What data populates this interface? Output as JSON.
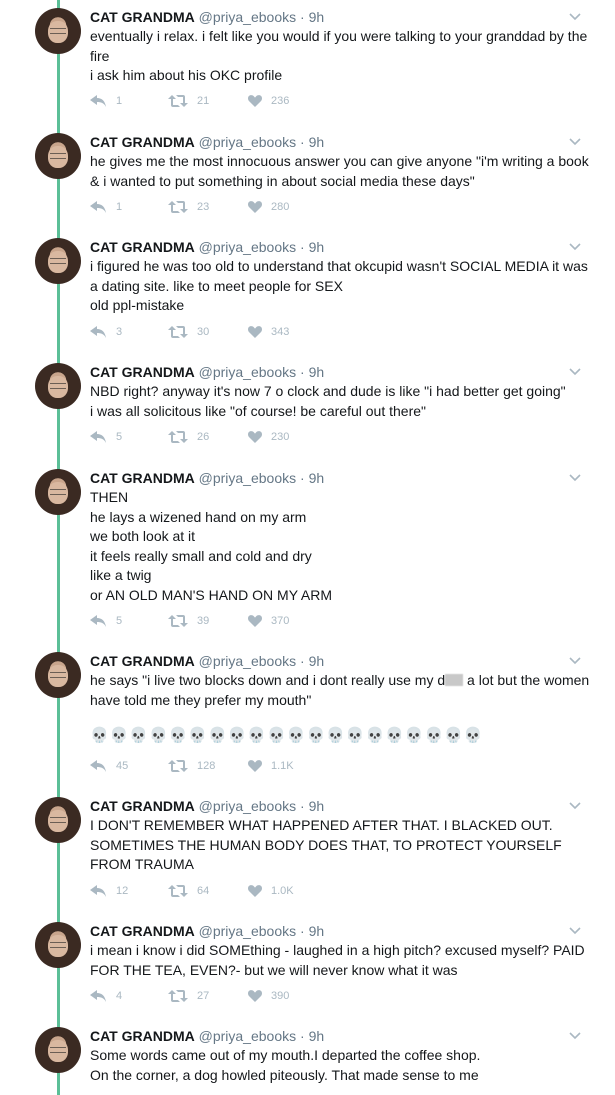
{
  "author": {
    "name": "CAT GRANDMA",
    "handle": "@priya_ebooks",
    "time": "· 9h"
  },
  "colors": {
    "thread": "#5bbf97",
    "action": "#aab8c2",
    "handle": "#657786"
  },
  "tweets": [
    {
      "lines": [
        "eventually i relax. i felt like you would if you were talking to your granddad by the fire",
        "i ask him about his OKC profile"
      ],
      "replies": "1",
      "retweets": "21",
      "likes": "236"
    },
    {
      "lines": [
        "he gives me the most innocuous answer you can give anyone \"i'm writing a book & i wanted to put something in about social media these days\""
      ],
      "replies": "1",
      "retweets": "23",
      "likes": "280"
    },
    {
      "lines": [
        "i figured he was too old to understand that okcupid wasn't SOCIAL MEDIA it was a dating site. like to meet people for SEX",
        "old ppl-mistake"
      ],
      "replies": "3",
      "retweets": "30",
      "likes": "343"
    },
    {
      "lines": [
        "NBD right? anyway it's now 7 o clock and dude is like \"i had better get going\"",
        "i was all solicitous like \"of course! be careful out there\""
      ],
      "replies": "5",
      "retweets": "26",
      "likes": "230"
    },
    {
      "lines": [
        "THEN",
        "he lays a wizened hand on my arm",
        "we both look at it",
        "it feels really small and cold and dry",
        "like a twig",
        "or AN OLD MAN'S HAND ON MY ARM"
      ],
      "replies": "5",
      "retweets": "39",
      "likes": "370"
    },
    {
      "lines_before": "he says \"i live two blocks down and i dont really use my d",
      "lines_after": " a lot but the women have told me they prefer my mouth\"",
      "skulls": "💀💀💀💀💀💀💀💀💀💀💀💀💀💀💀💀💀💀💀💀",
      "replies": "45",
      "retweets": "128",
      "likes": "1.1K"
    },
    {
      "lines": [
        "I DON'T REMEMBER WHAT HAPPENED AFTER THAT. I BLACKED OUT. SOMETIMES THE HUMAN BODY DOES THAT, TO PROTECT YOURSELF FROM TRAUMA"
      ],
      "replies": "12",
      "retweets": "64",
      "likes": "1.0K"
    },
    {
      "lines": [
        "i mean i know i did SOMEthing - laughed in a high pitch? excused myself? PAID FOR THE TEA, EVEN?- but we will never know what it was"
      ],
      "replies": "4",
      "retweets": "27",
      "likes": "390"
    },
    {
      "lines": [
        "Some words came out of my mouth.I departed the coffee shop.",
        "On the corner, a dog howled piteously. That made sense to me"
      ],
      "replies": "",
      "retweets": "",
      "likes": ""
    }
  ]
}
